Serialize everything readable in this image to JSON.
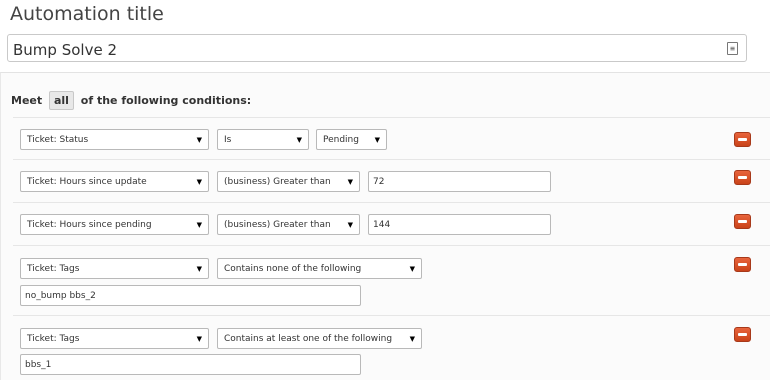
{
  "automation": {
    "heading": "Automation title",
    "title_value": "Bump Solve 2",
    "title_field_icon": "≡"
  },
  "conditions": {
    "meet_prefix": "Meet",
    "match_mode": "all",
    "meet_suffix": "of the following conditions:",
    "rows": [
      {
        "field": "Ticket: Status",
        "operator": "Is",
        "value": "Pending",
        "value_type": "select"
      },
      {
        "field": "Ticket: Hours since update",
        "operator": "(business) Greater than",
        "value": "72",
        "value_type": "text"
      },
      {
        "field": "Ticket: Hours since pending",
        "operator": "(business) Greater than",
        "value": "144",
        "value_type": "text"
      },
      {
        "field": "Ticket: Tags",
        "operator": "Contains none of the following",
        "value": "no_bump bbs_2",
        "value_type": "tags"
      },
      {
        "field": "Ticket: Tags",
        "operator": "Contains at least one of the following",
        "value": "bbs_1",
        "value_type": "tags"
      }
    ]
  },
  "icons": {
    "caret": "▼",
    "remove": "minus-icon"
  },
  "colors": {
    "remove_button": "#d9532a",
    "panel_background": "#fbfbfb"
  }
}
